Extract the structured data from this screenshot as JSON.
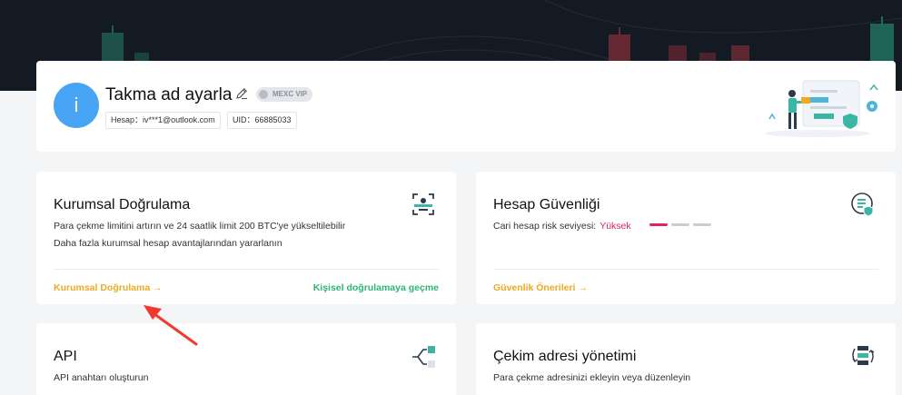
{
  "profile": {
    "avatar_initial": "i",
    "nickname": "Takma ad ayarla",
    "vip_badge": "MEXC VIP",
    "account_label": "Hesap：iv***1@outlook.com",
    "uid_label": "UID：66885033"
  },
  "institutional": {
    "title": "Kurumsal Doğrulama",
    "desc_line1": "Para çekme limitini artırın ve 24 saatlik limit 200 BTC'ye yükseltilebilir",
    "desc_line2": "Daha fazla kurumsal hesap avantajlarından yararlanın",
    "primary_link": "Kurumsal Doğrulama →",
    "secondary_link": "Kişisel doğrulamaya geçme"
  },
  "security": {
    "title": "Hesap Güvenliği",
    "risk_label": "Cari hesap risk seviyesi:",
    "risk_value": "Yüksek",
    "risk_level": 1,
    "risk_max": 3,
    "link": "Güvenlik Önerileri →"
  },
  "api": {
    "title": "API",
    "desc": "API anahtarı oluşturun"
  },
  "withdrawal": {
    "title": "Çekim adresi yönetimi",
    "desc": "Para çekme adresinizi ekleyin veya düzenleyin"
  },
  "colors": {
    "accent_orange": "#f0a820",
    "accent_green": "#2bb673",
    "risk_red": "#e0245e",
    "avatar_blue": "#48a5f5",
    "annotation_arrow": "#f03a2e"
  },
  "icons": {
    "institutional": "id-scan-icon",
    "security": "shield-document-icon",
    "api": "api-connect-icon",
    "withdrawal": "address-transfer-icon",
    "edit": "pencil-icon"
  }
}
